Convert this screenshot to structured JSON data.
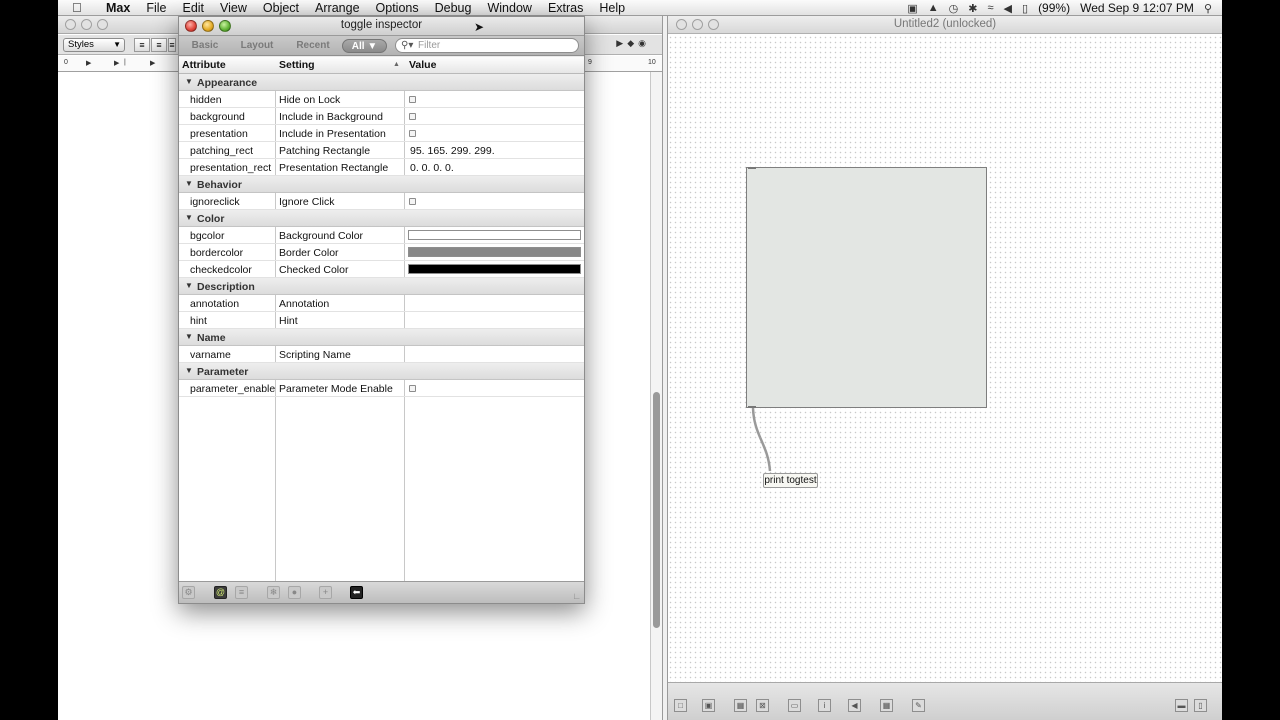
{
  "menubar": {
    "app": "Max",
    "items": [
      "File",
      "Edit",
      "View",
      "Object",
      "Arrange",
      "Options",
      "Debug",
      "Window",
      "Extras",
      "Help"
    ],
    "battery": "(99%)",
    "clock": "Wed Sep 9  12:07 PM"
  },
  "left_window": {
    "styles_label": "Styles",
    "ruler_left": "0",
    "ruler_right_a": "9",
    "ruler_right_b": "10"
  },
  "right_window": {
    "title": "Untitled2 (unlocked)",
    "print_object": "print togtest"
  },
  "inspector": {
    "title": "toggle inspector",
    "tabs": [
      "Basic",
      "Layout",
      "Recent",
      "All ▼"
    ],
    "active_tab": "All",
    "filter_placeholder": "Filter",
    "columns": {
      "attribute": "Attribute",
      "setting": "Setting",
      "value": "Value"
    },
    "rows": [
      {
        "type": "category",
        "label": "Appearance"
      },
      {
        "type": "attr",
        "attribute": "hidden",
        "setting": "Hide on Lock",
        "kind": "checkbox"
      },
      {
        "type": "attr",
        "attribute": "background",
        "setting": "Include in Background",
        "kind": "checkbox"
      },
      {
        "type": "attr",
        "attribute": "presentation",
        "setting": "Include in Presentation",
        "kind": "checkbox"
      },
      {
        "type": "attr",
        "attribute": "patching_rect",
        "setting": "Patching Rectangle",
        "kind": "text",
        "value": "95. 165. 299. 299."
      },
      {
        "type": "attr",
        "attribute": "presentation_rect",
        "setting": "Presentation Rectangle",
        "kind": "text",
        "value": "0. 0. 0. 0."
      },
      {
        "type": "category",
        "label": "Behavior"
      },
      {
        "type": "attr",
        "attribute": "ignoreclick",
        "setting": "Ignore Click",
        "kind": "checkbox"
      },
      {
        "type": "category",
        "label": "Color"
      },
      {
        "type": "attr",
        "attribute": "bgcolor",
        "setting": "Background Color",
        "kind": "color",
        "color": "#ffffff"
      },
      {
        "type": "attr",
        "attribute": "bordercolor",
        "setting": "Border Color",
        "kind": "color",
        "color": "#888888"
      },
      {
        "type": "attr",
        "attribute": "checkedcolor",
        "setting": "Checked Color",
        "kind": "color",
        "color": "#000000"
      },
      {
        "type": "category",
        "label": "Description"
      },
      {
        "type": "attr",
        "attribute": "annotation",
        "setting": "Annotation",
        "kind": "text",
        "value": ""
      },
      {
        "type": "attr",
        "attribute": "hint",
        "setting": "Hint",
        "kind": "text",
        "value": ""
      },
      {
        "type": "category",
        "label": "Name"
      },
      {
        "type": "attr",
        "attribute": "varname",
        "setting": "Scripting Name",
        "kind": "text",
        "value": ""
      },
      {
        "type": "category",
        "label": "Parameter"
      },
      {
        "type": "attr",
        "attribute": "parameter_enable",
        "setting": "Parameter Mode Enable",
        "kind": "checkbox"
      }
    ]
  }
}
